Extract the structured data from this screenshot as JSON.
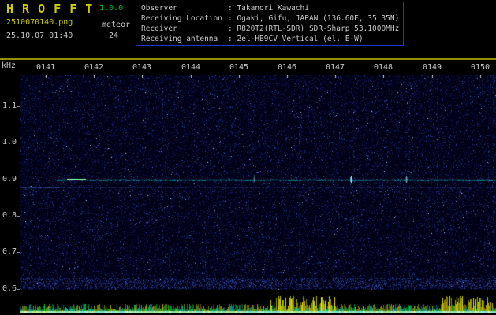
{
  "app": {
    "name_spaced": "H R O F F T",
    "version": "1.0.0",
    "filename": "2510070140.png",
    "datetime": "25.10.07 01:40",
    "mode": "meteor",
    "count": "24"
  },
  "info": {
    "rows": [
      {
        "label": "Observer",
        "value": ": Takanori Kawachi"
      },
      {
        "label": "Receiving Location",
        "value": ": Ogaki, Gifu, JAPAN (136.60E, 35.35N)"
      },
      {
        "label": "Receiver",
        "value": ": R820T2(RTL-SDR) SDR-Sharp 53.1000MHz"
      },
      {
        "label": "Receiving antenna",
        "value": ": 2el-HB9CV Vertical (el. E-W)"
      }
    ]
  },
  "chart_data": {
    "type": "heatmap",
    "ylabel": "kHz",
    "x_ticks": [
      "0141",
      "0142",
      "0143",
      "0144",
      "0145",
      "0146",
      "0147",
      "0148",
      "0149",
      "0150"
    ],
    "y_ticks": [
      "1.1",
      "1.0",
      "0.9",
      "0.8",
      "0.7",
      "0.6"
    ],
    "y_range_khz": [
      0.55,
      1.18
    ],
    "carrier_khz": 0.9,
    "carrier_visible_from": "0141",
    "echo_count": 24,
    "legend_position": "none",
    "grid": false,
    "panels": [
      "frequency-spectrogram",
      "signal-level-strip"
    ]
  },
  "colors": {
    "background": "#000000",
    "title_yellow": "#cccc00",
    "version_green": "#00bb33",
    "text": "#c8c8c8",
    "info_box_border": "#2233cc",
    "separator_yellow": "#909000",
    "plot_bg": "#000016",
    "noise_blue": "#2244bb",
    "carrier_cyan": "#00ddcc",
    "white_line": "#c0c0cc",
    "strip_yellow": "#cccc00",
    "strip_green": "#00aa44",
    "strip_cyan": "#00cccc"
  }
}
